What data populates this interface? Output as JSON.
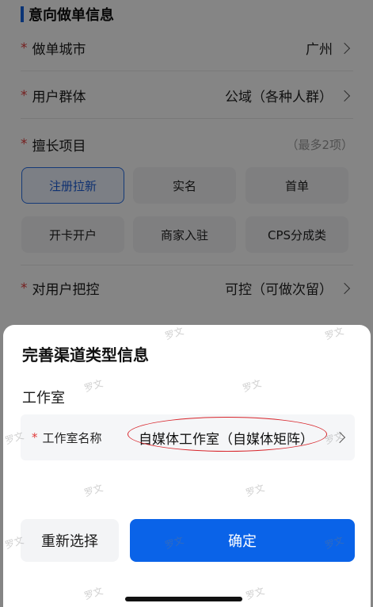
{
  "form": {
    "section_title": "意向做单信息",
    "required_mark": "*",
    "city": {
      "label": "做单城市",
      "value": "广州"
    },
    "user_group": {
      "label": "用户群体",
      "value": "公域（各种人群）"
    },
    "specialty": {
      "label": "擅长项目",
      "hint": "（最多2项）"
    },
    "chips": [
      {
        "label": "注册拉新",
        "selected": true
      },
      {
        "label": "实名",
        "selected": false
      },
      {
        "label": "首单",
        "selected": false
      },
      {
        "label": "开卡开户",
        "selected": false
      },
      {
        "label": "商家入驻",
        "selected": false
      },
      {
        "label": "CPS分成类",
        "selected": false
      }
    ],
    "user_control": {
      "label": "对用户把控",
      "value": "可控（可做次留）"
    }
  },
  "sheet": {
    "title": "完善渠道类型信息",
    "studio_label": "工作室",
    "name_field": {
      "required_mark": "*",
      "label": "工作室名称",
      "value": "自媒体工作室（自媒体矩阵）"
    },
    "reset_button": "重新选择",
    "confirm_button": "确定"
  },
  "watermark": "罗文",
  "colors": {
    "accent": "#0a63e8",
    "required": "#e03a3a",
    "highlight_oval": "#d8262c"
  }
}
